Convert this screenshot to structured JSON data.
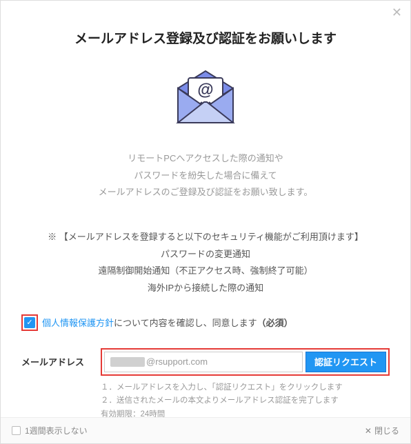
{
  "title": "メールアドレス登録及び認証をお願いします",
  "description": {
    "line1": "リモートPCへアクセスした際の通知や",
    "line2": "パスワードを紛失した場合に備えて",
    "line3": "メールアドレスのご登録及び認証をお願い致します。"
  },
  "security": {
    "header": "※ 【メールアドレスを登録すると以下のセキュリティ機能がご利用頂けます】",
    "line1": "パスワードの変更通知",
    "line2": "遠隔制御開始通知（不正アクセス時、強制終了可能）",
    "line3": "海外IPから接続した際の通知"
  },
  "consent": {
    "link": "個人情報保護方針",
    "text": "について内容を確認し、同意します",
    "required": "（必須）"
  },
  "email": {
    "label": "メールアドレス",
    "domain": "@rsupport.com",
    "button": "認証リクエスト",
    "hint1": "１．メールアドレスを入力し、「認証リクエスト」をクリックします",
    "hint2": "２．送信されたメールの本文よりメールアドレス認証を完了します",
    "hint3": "有効期限：24時間"
  },
  "footer": {
    "hide": "1週間表示しない",
    "close": "閉じる"
  }
}
